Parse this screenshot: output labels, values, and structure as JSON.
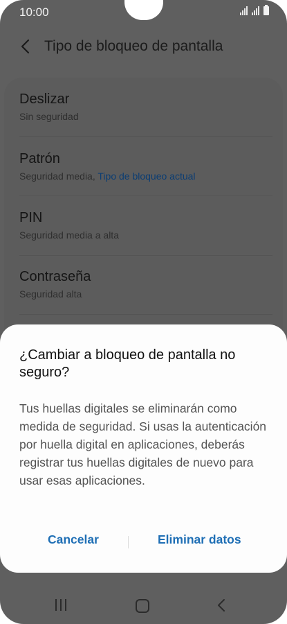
{
  "status_bar": {
    "time": "10:00",
    "icons": [
      "signal-icon",
      "signal-icon",
      "battery-icon"
    ]
  },
  "header": {
    "back_icon": "chevron-left-icon",
    "title": "Tipo de bloqueo de pantalla"
  },
  "lock_options": [
    {
      "title": "Deslizar",
      "subtitle": "Sin seguridad",
      "note": ""
    },
    {
      "title": "Patrón",
      "subtitle": "Seguridad media,",
      "note": "Tipo de bloqueo actual"
    },
    {
      "title": "PIN",
      "subtitle": "Seguridad media a alta",
      "note": ""
    },
    {
      "title": "Contraseña",
      "subtitle": "Seguridad alta",
      "note": ""
    }
  ],
  "dialog": {
    "title": "¿Cambiar a bloqueo de pantalla no seguro?",
    "body": "Tus huellas digitales se eliminarán como medida de seguridad. Si usas la autenticación por huella digital en aplicaciones, deberás registrar tus huellas digitales de nuevo para usar esas aplicaciones.",
    "cancel_label": "Cancelar",
    "confirm_label": "Eliminar datos"
  },
  "nav_bar": {
    "icons": [
      "recent-apps-icon",
      "home-icon",
      "back-icon"
    ]
  },
  "colors": {
    "accent": "#1f6fb5",
    "current_lock": "#0b3d73",
    "scrim": "#5f5f5f",
    "dialog_bg": "#fdfdfd"
  }
}
